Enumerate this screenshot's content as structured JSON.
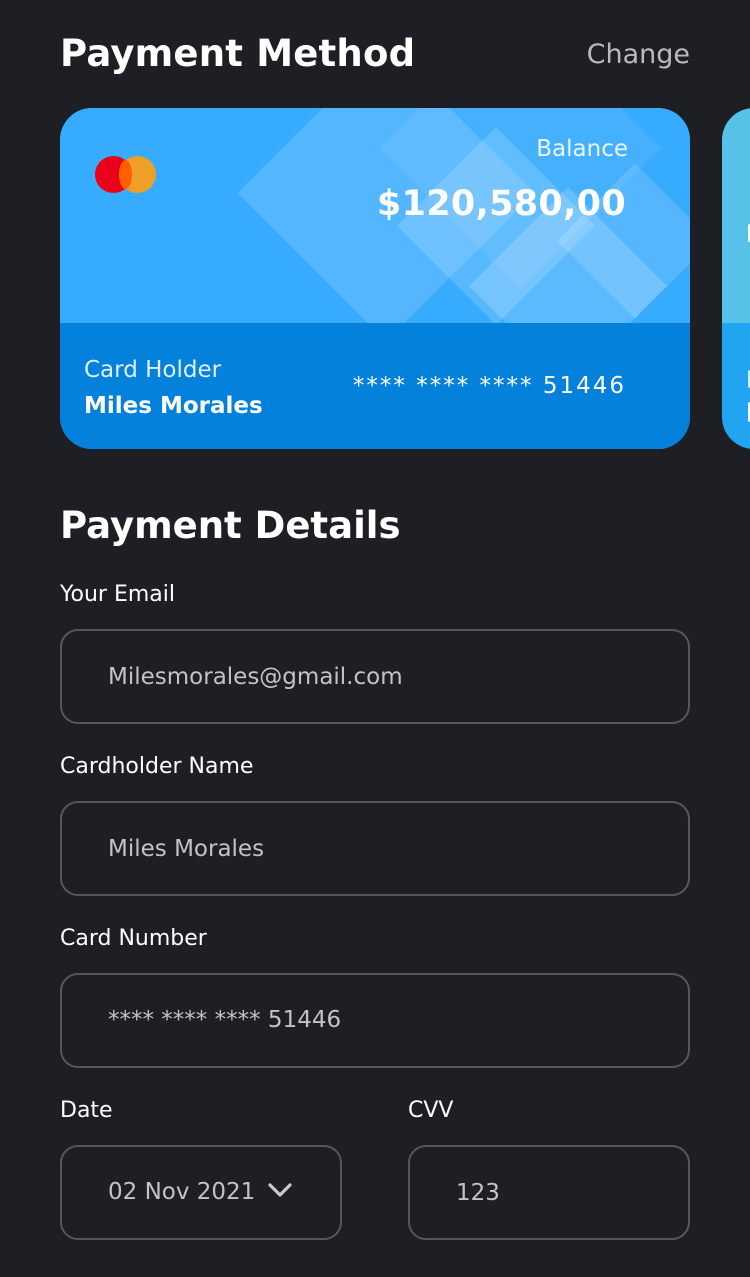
{
  "header": {
    "title": "Payment Method",
    "change_label": "Change"
  },
  "card": {
    "brand": "mastercard",
    "balance_label": "Balance",
    "balance_amount": "$120,580,00",
    "holder_label": "Card Holder",
    "holder_name": "Miles Morales",
    "masked_number": "**** **** **** 51446",
    "colors": {
      "top": "#37abfe",
      "bottom": "#0381db"
    }
  },
  "details": {
    "title": "Payment Details",
    "email": {
      "label": "Your Email",
      "value": "Milesmorales@gmail.com"
    },
    "cardholder": {
      "label": "Cardholder Name",
      "value": "Miles Morales"
    },
    "card_number": {
      "label": "Card Number",
      "value": "**** **** **** 51446"
    },
    "date": {
      "label": "Date",
      "value": "02 Nov 2021",
      "icon": "chevron-down-icon"
    },
    "cvv": {
      "label": "CVV",
      "value": "123"
    }
  },
  "theme": {
    "background": "#1e1f25",
    "field_border": "#55575f",
    "muted_text": "#b9bac0"
  }
}
